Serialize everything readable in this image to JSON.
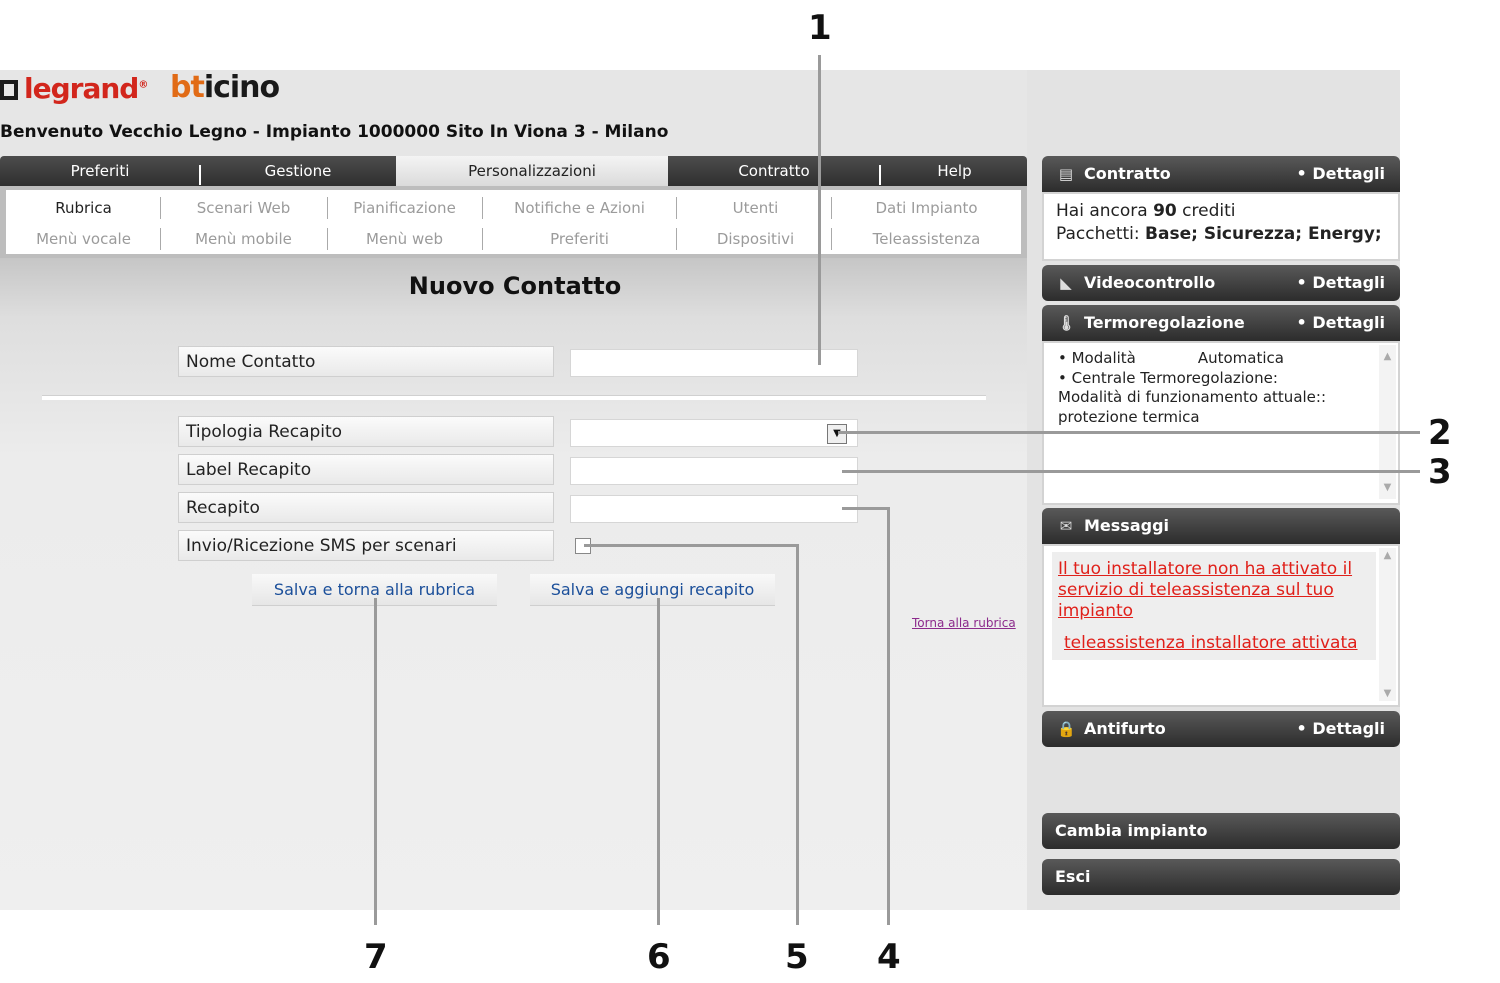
{
  "header": {
    "brand_legrand": "legrand",
    "brand_legrand_mark": "®",
    "brand_bticino_b": "bt",
    "brand_bticino_rest": "icino",
    "welcome": "Benvenuto Vecchio Legno - Impianto 1000000 Sito In Viona 3 - Milano"
  },
  "tabs": [
    "Preferiti",
    "Gestione",
    "Personalizzazioni",
    "Contratto",
    "Help"
  ],
  "active_tab": "Personalizzazioni",
  "submenu": {
    "row1": [
      "Rubrica",
      "Scenari Web",
      "Pianificazione",
      "Notifiche e Azioni",
      "Utenti",
      "Dati Impianto"
    ],
    "row2": [
      "Menù vocale",
      "Menù mobile",
      "Menù web",
      "Preferiti",
      "Dispositivi",
      "Teleassistenza"
    ],
    "active": "Rubrica"
  },
  "form": {
    "title": "Nuovo Contatto",
    "nome_label": "Nome Contatto",
    "nome_value": "",
    "tipologia_label": "Tipologia Recapito",
    "tipologia_value": "",
    "label_recapito_label": "Label Recapito",
    "label_recapito_value": "",
    "recapito_label": "Recapito",
    "recapito_value": "",
    "sms_label": "Invio/Ricezione SMS per scenari",
    "sms_checked": false,
    "save_back": "Salva e torna alla rubrica",
    "save_add": "Salva e aggiungi recapito",
    "back_link": "Torna alla rubrica"
  },
  "widgets": {
    "contratto": {
      "title": "Contratto",
      "details": "• Dettagli",
      "credits_pre": "Hai ancora ",
      "credits": "90",
      "credits_post": " crediti",
      "packages_label": "Pacchetti: ",
      "packages": "Base; Sicurezza; Energy;",
      "icon": "document-icon"
    },
    "videocontrollo": {
      "title": "Videocontrollo",
      "details": "• Dettagli",
      "icon": "camera-icon"
    },
    "termoregolazione": {
      "title": "Termoregolazione",
      "details": "• Dettagli",
      "icon": "thermometer-icon",
      "line1_label": "• Modalità",
      "line1_value": "Automatica",
      "line2": "• Centrale Termoregolazione:",
      "line3": "Modalità di funzionamento attuale::",
      "line4": "protezione termica"
    },
    "messaggi": {
      "title": "Messaggi",
      "icon": "envelope-icon",
      "items": [
        "Il tuo installatore non ha attivato il servizio di teleassistenza sul tuo impianto",
        "teleassistenza installatore attivata"
      ]
    },
    "antifurto": {
      "title": "Antifurto",
      "details": "• Dettagli",
      "icon": "lock-icon"
    },
    "cambia_impianto": "Cambia impianto",
    "esci": "Esci"
  },
  "callouts": [
    "1",
    "2",
    "3",
    "4",
    "5",
    "6",
    "7"
  ],
  "colors": {
    "brand_red": "#d2261c",
    "brand_orange": "#e16b16",
    "link_blue": "#1b4f9a",
    "message_red": "#e0201a"
  }
}
